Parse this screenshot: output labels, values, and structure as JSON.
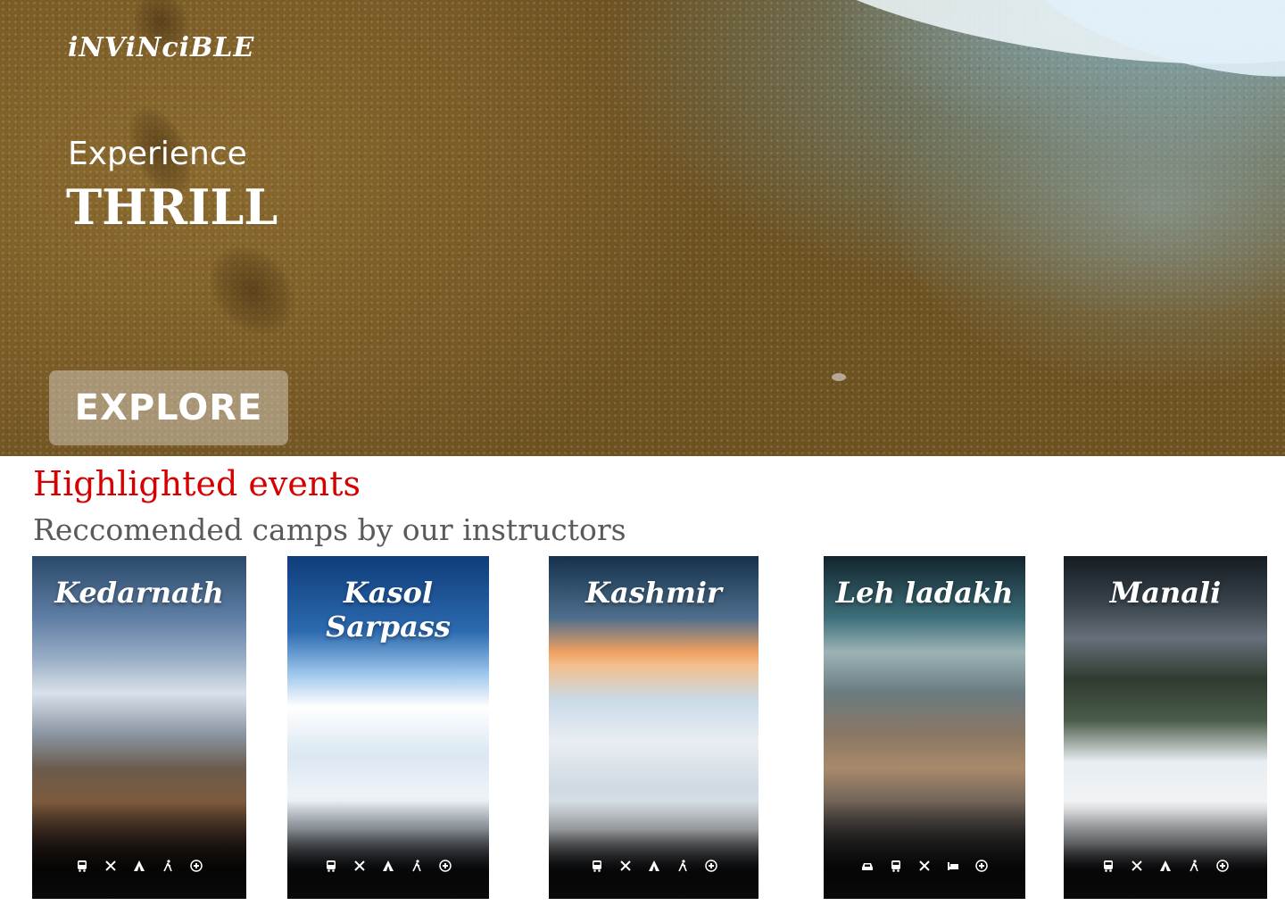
{
  "brand": "iNViNciBLE",
  "hero": {
    "subtitle": "Experience",
    "title": "THRILL",
    "explore_label": "EXPLORE"
  },
  "section": {
    "title": "Highlighted events",
    "subtitle": "Reccomended camps by our instructors"
  },
  "cards": [
    {
      "name": "Kedarnath",
      "icons": [
        "bus-icon",
        "food-icon",
        "tent-icon",
        "hiking-icon",
        "medical-icon"
      ]
    },
    {
      "name": "Kasol Sarpass",
      "icons": [
        "bus-icon",
        "food-icon",
        "tent-icon",
        "hiking-icon",
        "medical-icon"
      ]
    },
    {
      "name": "Kashmir",
      "icons": [
        "bus-icon",
        "food-icon",
        "tent-icon",
        "hiking-icon",
        "medical-icon"
      ]
    },
    {
      "name": "Leh ladakh",
      "icons": [
        "car-icon",
        "bus-icon",
        "food-icon",
        "bed-icon",
        "medical-icon"
      ]
    },
    {
      "name": "Manali",
      "icons": [
        "bus-icon",
        "food-icon",
        "tent-icon",
        "hiking-icon",
        "medical-icon"
      ]
    }
  ],
  "colors": {
    "section_title": "#d60000",
    "section_subtitle": "#5a5a5a",
    "explore_bg": "rgba(225,220,210,0.45)"
  }
}
